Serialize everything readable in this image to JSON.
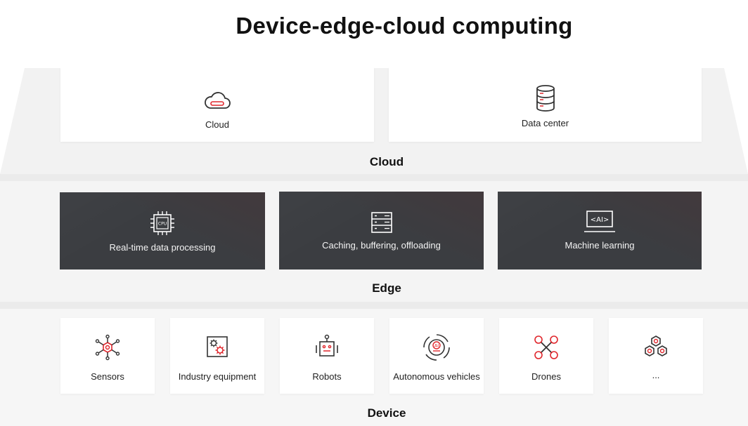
{
  "title": "Device-edge-cloud computing",
  "tiers": {
    "cloud": {
      "label": "Cloud",
      "items": [
        {
          "label": "Cloud",
          "icon": "cloud-icon"
        },
        {
          "label": "Data center",
          "icon": "database-icon"
        }
      ]
    },
    "edge": {
      "label": "Edge",
      "items": [
        {
          "label": "Real-time data processing",
          "icon": "cpu-chip-icon",
          "chip_text": "CPU"
        },
        {
          "label": "Caching, buffering, offloading",
          "icon": "server-rack-icon"
        },
        {
          "label": "Machine learning",
          "icon": "ai-monitor-icon",
          "screen_text": "<AI>"
        }
      ]
    },
    "device": {
      "label": "Device",
      "items": [
        {
          "label": "Sensors",
          "icon": "sensor-network-icon"
        },
        {
          "label": "Industry equipment",
          "icon": "gear-equipment-icon"
        },
        {
          "label": "Robots",
          "icon": "robot-icon"
        },
        {
          "label": "Autonomous vehicles",
          "icon": "autonomous-vehicle-icon",
          "badge_text": "AI"
        },
        {
          "label": "Drones",
          "icon": "drone-icon"
        },
        {
          "label": "...",
          "icon": "hexagon-cluster-icon"
        }
      ]
    }
  },
  "colors": {
    "accent_red": "#e0262c",
    "icon_dark": "#333333",
    "icon_light": "#ffffff",
    "edge_card_bg": "#3b3d41",
    "page_bg": "#ffffff",
    "band_bg": "#f3f3f3"
  }
}
